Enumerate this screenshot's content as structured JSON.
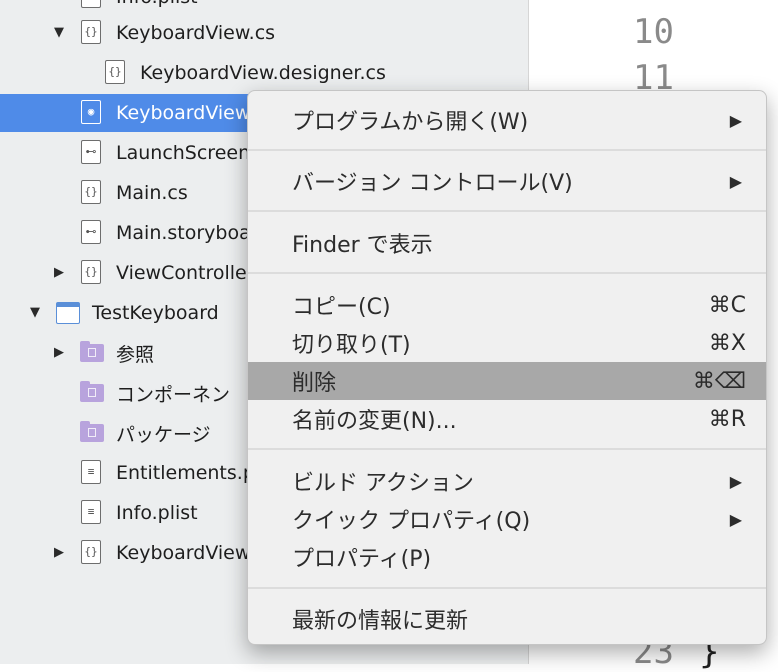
{
  "tree": {
    "items": [
      {
        "label": "Info.plist",
        "icon": "plist-icon"
      },
      {
        "label": "KeyboardView.cs",
        "icon": "csharp-file-icon",
        "disclosure": "▼"
      },
      {
        "label": "KeyboardView.designer.cs",
        "icon": "csharp-file-icon"
      },
      {
        "label": "KeyboardView",
        "icon": "xib-file-icon"
      },
      {
        "label": "LaunchScreen",
        "icon": "storyboard-icon"
      },
      {
        "label": "Main.cs",
        "icon": "csharp-file-icon"
      },
      {
        "label": "Main.storyboa",
        "icon": "storyboard-icon"
      },
      {
        "label": "ViewControlle",
        "icon": "csharp-file-icon",
        "disclosure": "▶"
      },
      {
        "label": "TestKeyboard",
        "icon": "project-icon",
        "disclosure": "▼"
      },
      {
        "label": "参照",
        "icon": "folder-icon",
        "disclosure": "▶"
      },
      {
        "label": "コンポーネン",
        "icon": "folder-icon"
      },
      {
        "label": "パッケージ",
        "icon": "folder-icon"
      },
      {
        "label": "Entitlements.p",
        "icon": "plist-icon"
      },
      {
        "label": "Info.plist",
        "icon": "plist-icon"
      },
      {
        "label": "KeyboardView",
        "icon": "csharp-file-icon",
        "disclosure": "▶"
      }
    ],
    "file_glyph": "{}",
    "plist_glyph": "≡",
    "storyboard_glyph": "⊷",
    "xib_glyph": "◉"
  },
  "editor": {
    "line_numbers": [
      "10",
      "11",
      "23"
    ],
    "brace": "}"
  },
  "menu": {
    "open_with": "プログラムから開く(W)",
    "version_control": "バージョン コントロール(V)",
    "show_in_finder": "Finder で表示",
    "copy": "コピー(C)",
    "copy_shortcut": "⌘C",
    "cut": "切り取り(T)",
    "cut_shortcut": "⌘X",
    "delete": "削除",
    "delete_shortcut": "⌘⌫",
    "rename": "名前の変更(N)...",
    "rename_shortcut": "⌘R",
    "build_action": "ビルド アクション",
    "quick_properties": "クイック プロパティ(Q)",
    "properties": "プロパティ(P)",
    "refresh": "最新の情報に更新",
    "submenu_arrow": "▶"
  },
  "colors": {
    "selection": "#4f8be8",
    "menu_highlight": "#a8a8a8",
    "folder": "#b8a3dd"
  }
}
